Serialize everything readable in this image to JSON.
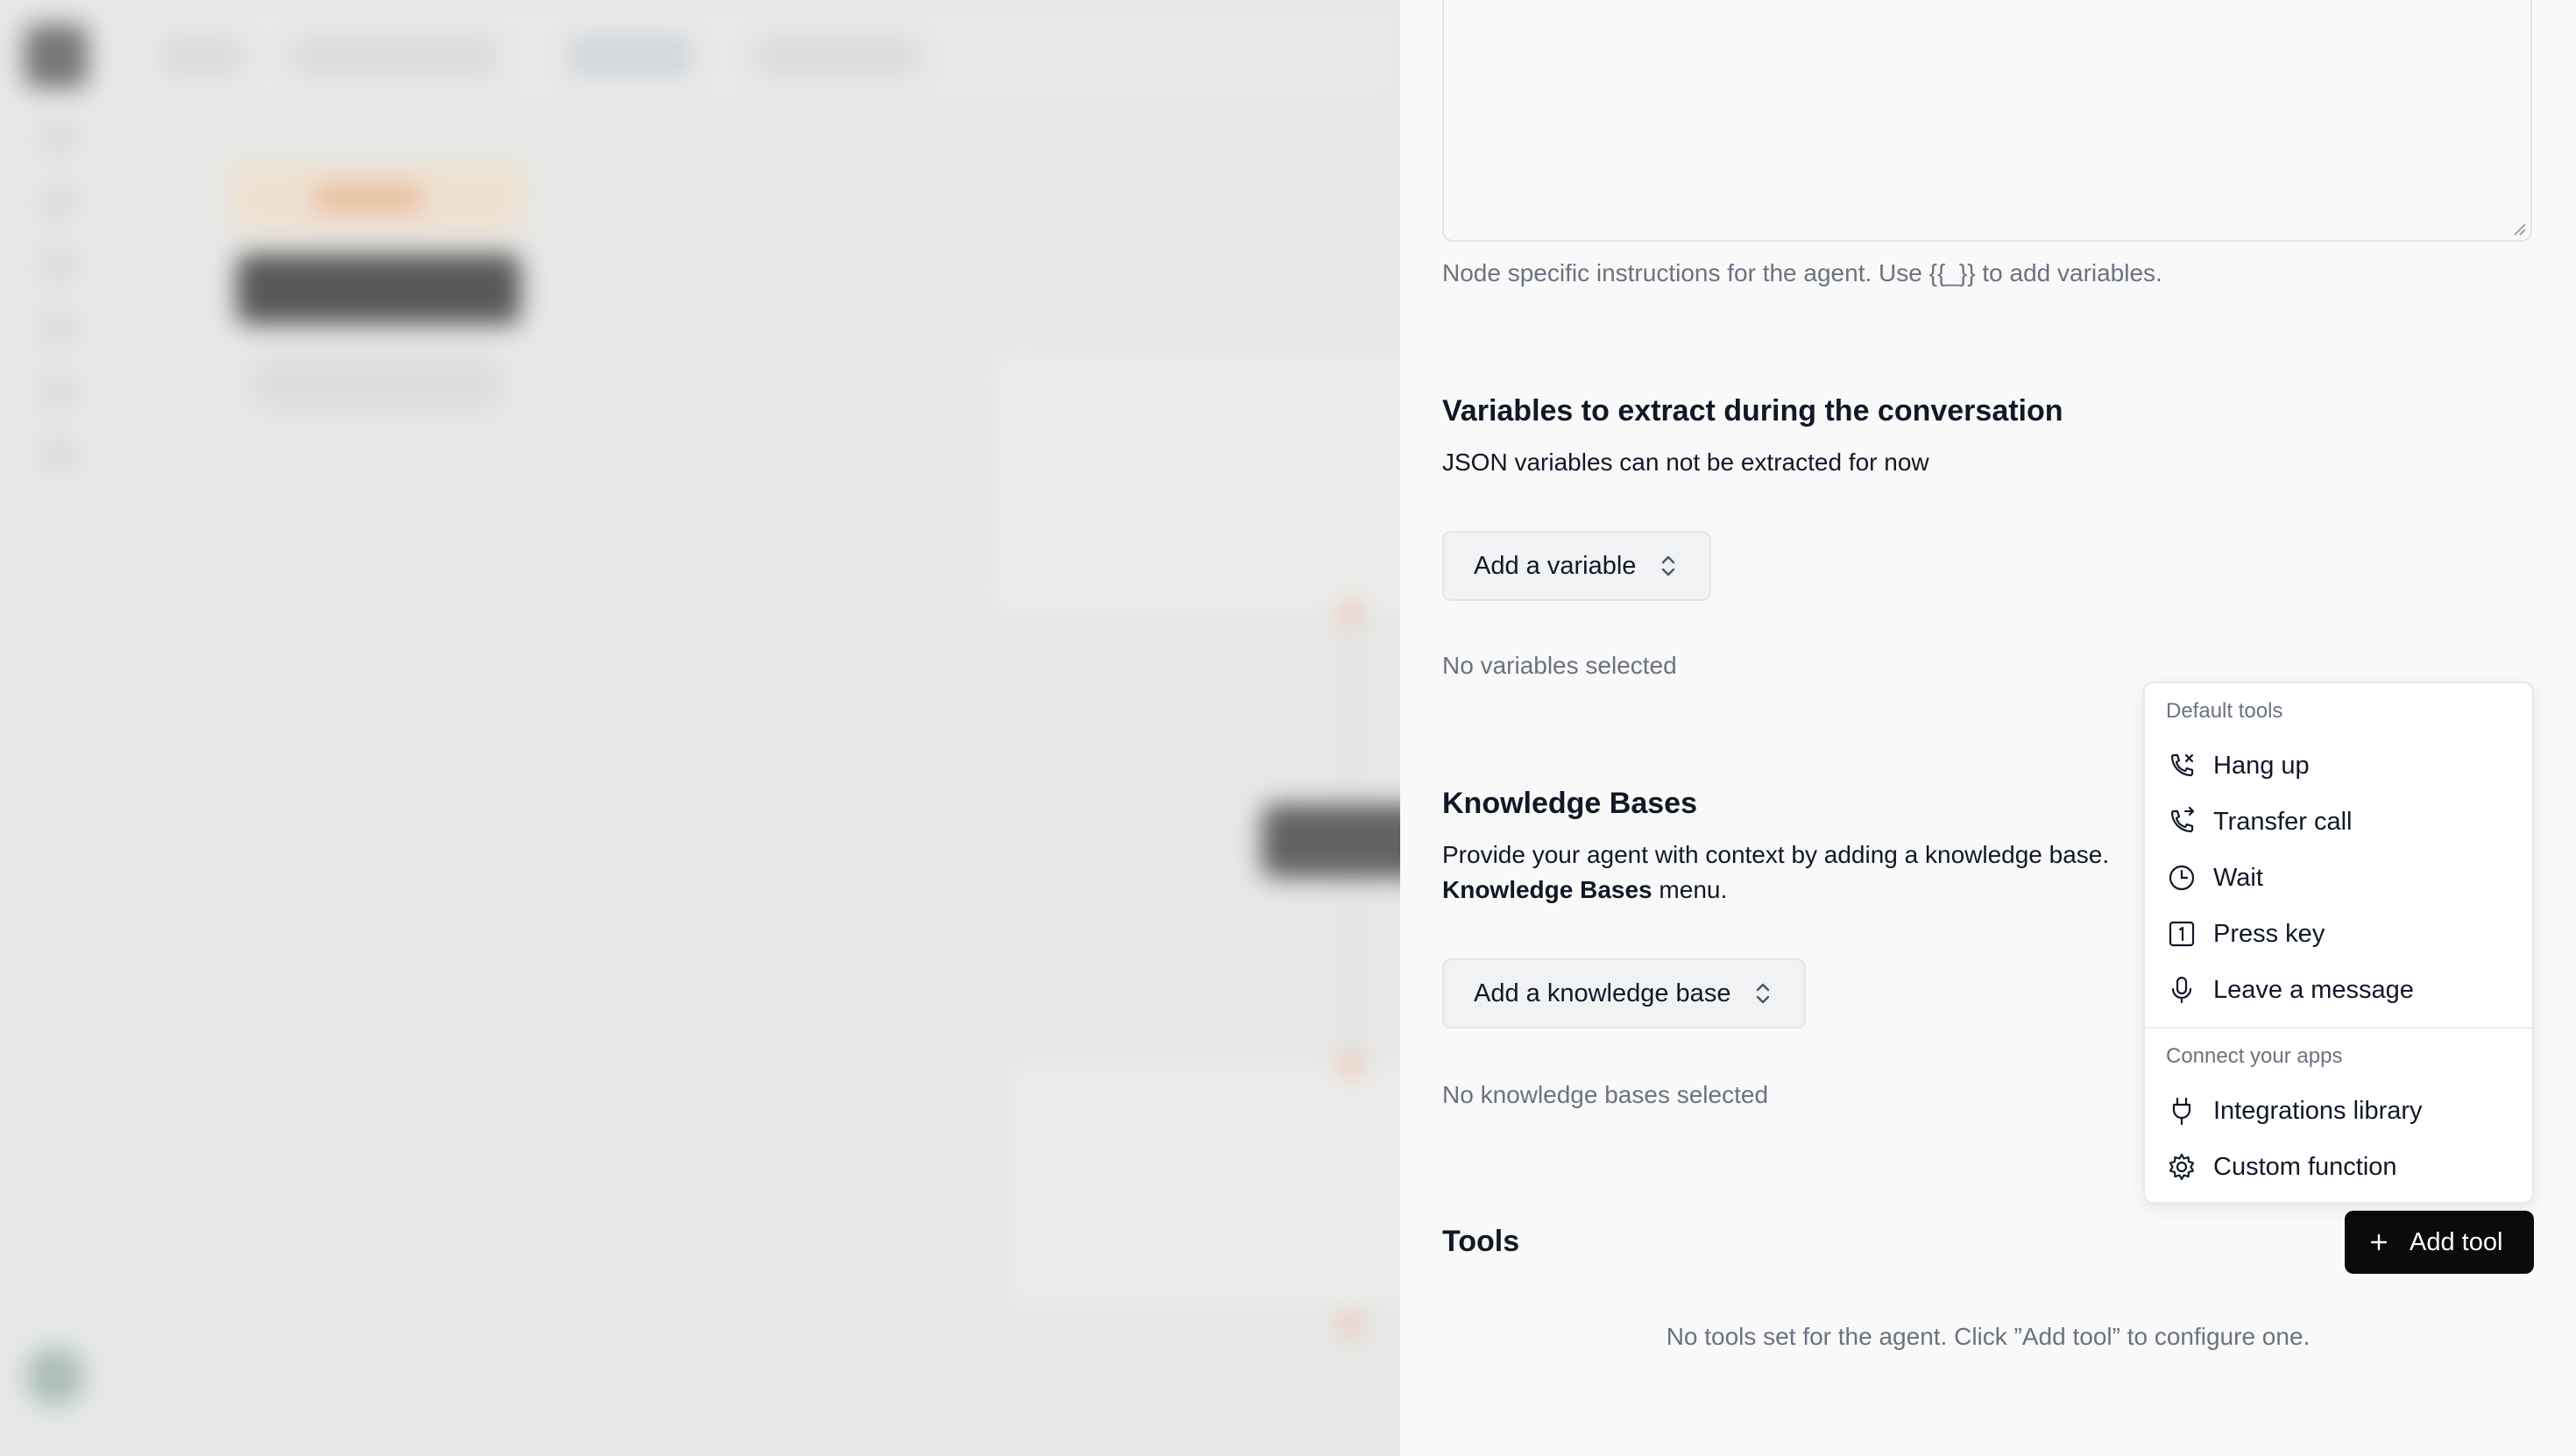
{
  "panel": {
    "instructions_help": "Node specific instructions for the agent. Use {{_}} to add variables.",
    "variables": {
      "title": "Variables to extract during the conversation",
      "subtitle": "JSON variables can not be extracted for now",
      "add_label": "Add a variable",
      "empty": "No variables selected"
    },
    "knowledge": {
      "title": "Knowledge Bases",
      "desc_prefix": "Provide your agent with context by adding a knowledge base.",
      "desc_bold": "Knowledge Bases",
      "desc_suffix": " menu.",
      "add_label": "Add a knowledge base",
      "empty": "No knowledge bases selected"
    },
    "tools": {
      "title": "Tools",
      "add_label": "Add tool",
      "empty": "No tools set for the agent. Click ”Add tool” to configure one."
    }
  },
  "menu": {
    "default_label": "Default tools",
    "default_items": [
      {
        "label": "Hang up",
        "icon": "phone-hangup-icon"
      },
      {
        "label": "Transfer call",
        "icon": "phone-transfer-icon"
      },
      {
        "label": "Wait",
        "icon": "clock-icon"
      },
      {
        "label": "Press key",
        "icon": "key-1-icon"
      },
      {
        "label": "Leave a message",
        "icon": "microphone-icon"
      }
    ],
    "apps_label": "Connect your apps",
    "apps_items": [
      {
        "label": "Integrations library",
        "icon": "plug-icon"
      },
      {
        "label": "Custom function",
        "icon": "gear-icon"
      }
    ]
  },
  "colors": {
    "panel_bg": "#f8f9f8",
    "primary_button": "#0b0b0c",
    "muted_text": "#6b7280",
    "overlay_bg": "#e6e7e6"
  }
}
